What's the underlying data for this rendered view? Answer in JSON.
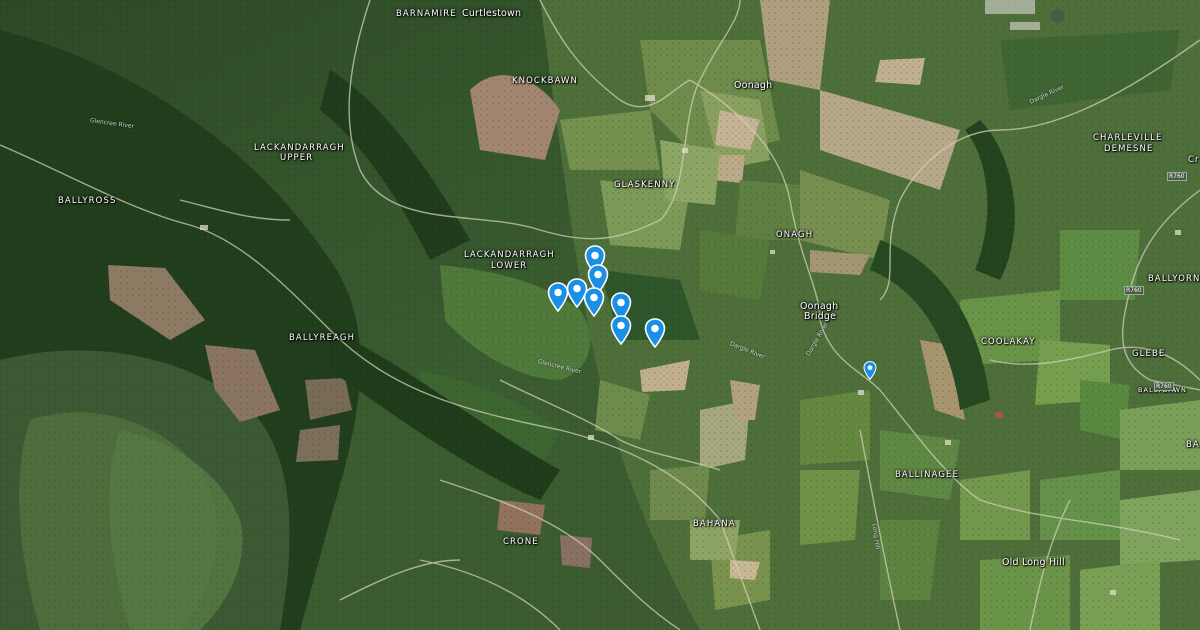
{
  "map": {
    "places_caps": [
      {
        "id": "barnamire",
        "text": "BARNAMIRE"
      },
      {
        "id": "knockbawn",
        "text": "KNOCKBAWN"
      },
      {
        "id": "lackandarragh-upper-1",
        "text": "LACKANDARRAGH"
      },
      {
        "id": "lackandarragh-upper-2",
        "text": "UPPER"
      },
      {
        "id": "ballyross",
        "text": "BALLYROSS"
      },
      {
        "id": "glaskenny",
        "text": "GLASKENNY"
      },
      {
        "id": "lackandarragh-lower-1",
        "text": "LACKANDARRAGH"
      },
      {
        "id": "lackandarragh-lower-2",
        "text": "LOWER"
      },
      {
        "id": "onagh",
        "text": "ONAGH"
      },
      {
        "id": "ballyreagh",
        "text": "BALLYREAGH"
      },
      {
        "id": "charleville-1",
        "text": "CHARLEVILLE"
      },
      {
        "id": "charleville-2",
        "text": "DEMESNE"
      },
      {
        "id": "ballyorney",
        "text": "BALLYORNE"
      },
      {
        "id": "coolakay",
        "text": "COOLAKAY"
      },
      {
        "id": "glebe",
        "text": "GLEBE"
      },
      {
        "id": "ballybawn",
        "text": "BALLYBAWN"
      },
      {
        "id": "ballinagee",
        "text": "BALLINAGEE"
      },
      {
        "id": "bahana",
        "text": "BAHANA"
      },
      {
        "id": "crone",
        "text": "CRONE"
      },
      {
        "id": "edge-cr",
        "text": "Cr"
      },
      {
        "id": "edge-ba",
        "text": "BA"
      }
    ],
    "places_normal": [
      {
        "id": "curtlestown",
        "text": "Curtlestown"
      },
      {
        "id": "oonagh",
        "text": "Oonagh"
      },
      {
        "id": "oonagh-bridge-1",
        "text": "Oonagh"
      },
      {
        "id": "oonagh-bridge-2",
        "text": "Bridge"
      },
      {
        "id": "old-long-hill",
        "text": "Old Long Hill"
      }
    ],
    "rivers": [
      {
        "id": "glencree-river",
        "text": "Glencree River"
      },
      {
        "id": "glencree-river-2",
        "text": "Glencree River"
      },
      {
        "id": "dargle-river",
        "text": "Dargle River"
      },
      {
        "id": "dargle-river-2",
        "text": "Dargle River"
      },
      {
        "id": "glencullen",
        "text": "Dargle River"
      },
      {
        "id": "long-hill-road",
        "text": "Long Hill"
      }
    ],
    "roads": [
      {
        "id": "r760-a",
        "text": "R760"
      },
      {
        "id": "r760-b",
        "text": "R760"
      },
      {
        "id": "r760-c",
        "text": "R760"
      }
    ],
    "pins": [
      {
        "id": "pin-1"
      },
      {
        "id": "pin-2"
      },
      {
        "id": "pin-3"
      },
      {
        "id": "pin-4"
      },
      {
        "id": "pin-5"
      },
      {
        "id": "pin-6"
      },
      {
        "id": "pin-7"
      },
      {
        "id": "pin-8"
      },
      {
        "id": "pin-9"
      },
      {
        "id": "pin-10"
      }
    ],
    "colors": {
      "pin_fill": "#1a8fe6",
      "pin_dot": "#ffffff",
      "forest_dark": "#1f3a1c",
      "forest": "#2f5a2a",
      "field_light": "#7d9a5a",
      "field_brown": "#a58770",
      "road": "#c8c8b0"
    }
  }
}
